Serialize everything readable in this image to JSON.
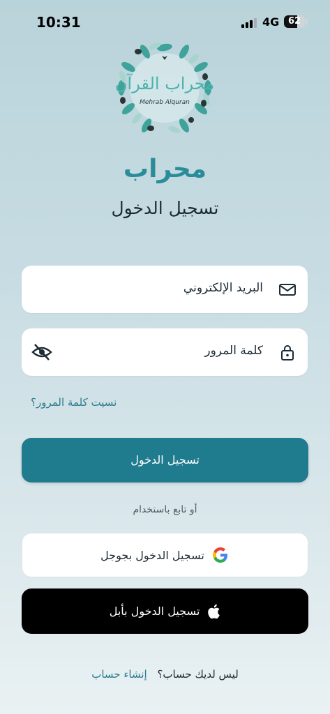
{
  "status_bar": {
    "time": "10:31",
    "network": "4G",
    "battery": "62"
  },
  "logo": {
    "arabic_text": "محراب القرآن",
    "latin_text": "Mehrab Alquran"
  },
  "app_title": "محراب",
  "page_subtitle": "تسجيل الدخول",
  "form": {
    "email_placeholder": "البريد الإلكتروني",
    "password_placeholder": "كلمة المرور",
    "forgot_password": "نسيت كلمة المرور؟",
    "login_button": "تسجيل الدخول"
  },
  "divider_text": "أو تابع باستخدام",
  "social": {
    "google_label": "تسجيل الدخول بجوجل",
    "apple_label": "تسجيل الدخول بأبل"
  },
  "footer": {
    "question": "ليس لديك حساب؟",
    "signup_link": "إنشاء حساب"
  },
  "colors": {
    "accent": "#1f7b8e",
    "title": "#2a8c99",
    "link": "#2a7b8c"
  }
}
